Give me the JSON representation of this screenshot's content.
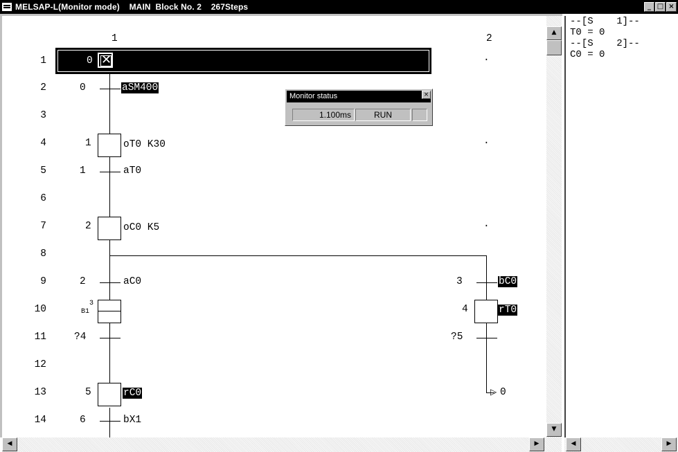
{
  "window": {
    "title": "MELSAP-L(Monitor mode)    MAIN  Block No. 2    267Steps",
    "min_glyph": "_",
    "max_glyph": "□",
    "close_glyph": "×"
  },
  "columns": [
    "1",
    "2"
  ],
  "rows": [
    "1",
    "2",
    "3",
    "4",
    "5",
    "6",
    "7",
    "8",
    "9",
    "10",
    "11",
    "12",
    "13",
    "14"
  ],
  "sfc": {
    "initial_step_no": "0",
    "t0_no": "0",
    "t0_cond": "aSM400",
    "s1_no": "1",
    "s1_op": "oT0 K30",
    "t1_no": "1",
    "t1_cond": "aT0",
    "s2_no": "2",
    "s2_op": "oC0 K5",
    "t2_no": "2",
    "t2_cond": "aC0",
    "block_top": "3",
    "block_bottom": "B1",
    "jump_left": "?4",
    "s5_no": "5",
    "s5_op": "rC0",
    "t6_no": "6",
    "t6_cond": "bX1",
    "t3_no": "3",
    "t3_cond": "bC0",
    "s4_no": "4",
    "s4_op": "rT0",
    "jump_right": "?5",
    "jump_target": "0",
    "dot": "·"
  },
  "monitor_status": {
    "title": "Monitor status",
    "scan_time": "1.100ms",
    "state": "RUN",
    "close_glyph": "×"
  },
  "right_pane": {
    "lines": [
      "--[S    1]--",
      "T0 = 0",
      "--[S    2]--",
      "C0 = 0"
    ]
  },
  "scroll": {
    "up": "▲",
    "down": "▼",
    "left": "◀",
    "right": "▶"
  }
}
